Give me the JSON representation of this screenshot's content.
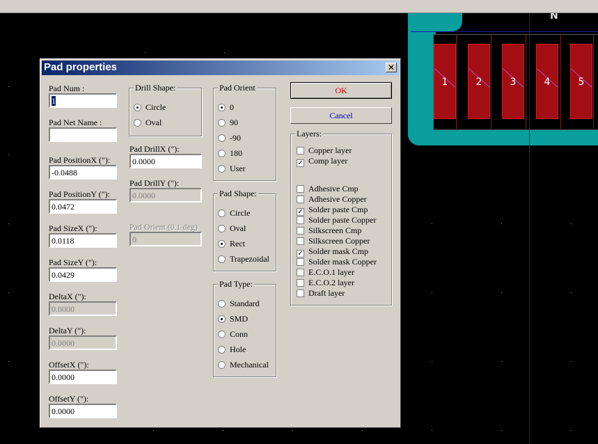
{
  "board": {
    "ref_label": "N",
    "pads": [
      "1",
      "2",
      "3",
      "4",
      "5"
    ],
    "colors": {
      "copper_outline": "#0a9e9e",
      "pad": "#a30d14",
      "background": "#000000"
    }
  },
  "dialog": {
    "title": "Pad properties",
    "close_glyph": "✕",
    "fields": {
      "pad_num": {
        "label": "Pad Num :",
        "value": "1"
      },
      "pad_net_name": {
        "label": "Pad Net Name :",
        "value": ""
      },
      "pos_x": {
        "label": "Pad PositionX (\"):",
        "value": "-0.0488"
      },
      "pos_y": {
        "label": "Pad PositionY (\"):",
        "value": "0.0472"
      },
      "size_x": {
        "label": "Pad SizeX (\"):",
        "value": "0.0118"
      },
      "size_y": {
        "label": "Pad SizeY (\"):",
        "value": "0.0429"
      },
      "delta_x": {
        "label": "DeltaX (\"):",
        "value": "0.0000"
      },
      "delta_y": {
        "label": "DeltaY (\"):",
        "value": "0.0000"
      },
      "offset_x": {
        "label": "OffsetX (\"):",
        "value": "0.0000"
      },
      "offset_y": {
        "label": "OffsetY (\"):",
        "value": "0.0000"
      },
      "drill_x": {
        "label": "Pad DrillX (\"):",
        "value": "0.0000"
      },
      "drill_y": {
        "label": "Pad DrillY (\"):",
        "value": "0.0000"
      },
      "pad_orient": {
        "label": "Pad Orient (0.1 deg)",
        "value": "0"
      }
    },
    "drill_shape": {
      "title": "Drill Shape:",
      "options": [
        "Circle",
        "Oval"
      ],
      "selected": "Circle"
    },
    "pad_orient": {
      "title": "Pad Orient",
      "options": [
        "0",
        "90",
        "-90",
        "180",
        "User"
      ],
      "selected": "0"
    },
    "pad_shape": {
      "title": "Pad Shape:",
      "options": [
        "Circle",
        "Oval",
        "Rect",
        "Trapezoidal"
      ],
      "selected": "Rect"
    },
    "pad_type": {
      "title": "Pad Type:",
      "options": [
        "Standard",
        "SMD",
        "Conn",
        "Hole",
        "Mechanical"
      ],
      "selected": "SMD"
    },
    "buttons": {
      "ok": "OK",
      "cancel": "Cancel"
    },
    "layers": {
      "title": "Layers:",
      "group_a": [
        {
          "label": "Copper layer",
          "checked": false
        },
        {
          "label": "Comp layer",
          "checked": true
        }
      ],
      "group_b": [
        {
          "label": "Adhesive Cmp",
          "checked": false
        },
        {
          "label": "Adhesive Copper",
          "checked": false
        },
        {
          "label": "Solder paste Cmp",
          "checked": true
        },
        {
          "label": "Solder paste Copper",
          "checked": false
        },
        {
          "label": "Silkscreen Cmp",
          "checked": false
        },
        {
          "label": "Silkscreen Copper",
          "checked": false
        },
        {
          "label": "Solder mask Cmp",
          "checked": true
        },
        {
          "label": "Solder mask Copper",
          "checked": false
        },
        {
          "label": "E.C.O.1 layer",
          "checked": false
        },
        {
          "label": "E.C.O.2 layer",
          "checked": false
        },
        {
          "label": "Draft layer",
          "checked": false
        }
      ]
    }
  }
}
